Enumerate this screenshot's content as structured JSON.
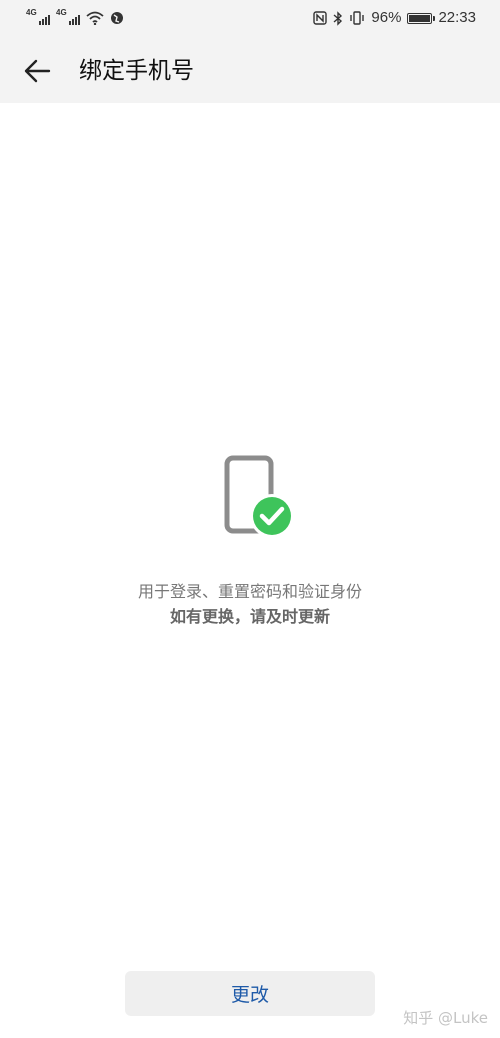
{
  "status_bar": {
    "signal1_tag": "4G",
    "signal2_tag": "4G",
    "nfc_label": "N",
    "bluetooth_label": "✱",
    "vibrate_label": "▯",
    "battery_percent": "96%",
    "battery_level": 0.96,
    "time": "22:33"
  },
  "header": {
    "title": "绑定手机号",
    "back_icon": "arrow-left-icon"
  },
  "main": {
    "icon": "phone-check-icon",
    "line1": "用于登录、重置密码和验证身份",
    "line2": "如有更换，请及时更新"
  },
  "footer": {
    "change_label": "更改",
    "watermark": "知乎 @Luke"
  },
  "colors": {
    "accent_blue": "#1e5aa8",
    "check_green": "#3ec45b",
    "phone_gray": "#8c8c8c",
    "header_bg": "#f3f3f3"
  }
}
